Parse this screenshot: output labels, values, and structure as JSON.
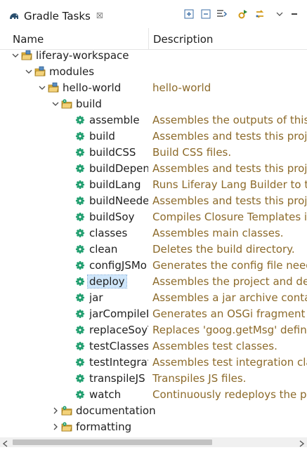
{
  "view": {
    "title": "Gradle Tasks",
    "close_glyph": "☒",
    "icon": "gradle-elephant-icon",
    "toolbar": [
      "expand-all-icon",
      "collapse-all-icon",
      "filter-icon",
      "run-tasks-icon",
      "refresh-icon",
      "view-menu-icon",
      "minimize-icon"
    ]
  },
  "columns": {
    "name": "Name",
    "description": "Description"
  },
  "tree": [
    {
      "label": "liferay-workspace",
      "desc": "",
      "level": 0,
      "state": "expanded",
      "kind": "project",
      "selected": false
    },
    {
      "label": "modules",
      "desc": "",
      "level": 1,
      "state": "expanded",
      "kind": "project",
      "selected": false
    },
    {
      "label": "hello-world",
      "desc": "hello-world",
      "level": 2,
      "state": "expanded",
      "kind": "project",
      "selected": false
    },
    {
      "label": "build",
      "desc": "",
      "level": 3,
      "state": "expanded",
      "kind": "group",
      "selected": false
    },
    {
      "label": "assemble",
      "desc": "Assembles the outputs of this pro",
      "level": 4,
      "state": "leaf",
      "kind": "task",
      "selected": false
    },
    {
      "label": "build",
      "desc": "Assembles and tests this project.",
      "level": 4,
      "state": "leaf",
      "kind": "task",
      "selected": false
    },
    {
      "label": "buildCSS",
      "desc": "Build CSS files.",
      "level": 4,
      "state": "leaf",
      "kind": "task",
      "selected": false
    },
    {
      "label": "buildDepen",
      "desc": "Assembles and tests this project a",
      "level": 4,
      "state": "leaf",
      "kind": "task",
      "selected": false
    },
    {
      "label": "buildLang",
      "desc": "Runs Liferay Lang Builder to trans",
      "level": 4,
      "state": "leaf",
      "kind": "task",
      "selected": false
    },
    {
      "label": "buildNeede",
      "desc": "Assembles and tests this project a",
      "level": 4,
      "state": "leaf",
      "kind": "task",
      "selected": false
    },
    {
      "label": "buildSoy",
      "desc": "Compiles Closure Templates into",
      "level": 4,
      "state": "leaf",
      "kind": "task",
      "selected": false
    },
    {
      "label": "classes",
      "desc": "Assembles main classes.",
      "level": 4,
      "state": "leaf",
      "kind": "task",
      "selected": false
    },
    {
      "label": "clean",
      "desc": "Deletes the build directory.",
      "level": 4,
      "state": "leaf",
      "kind": "task",
      "selected": false
    },
    {
      "label": "configJSMo",
      "desc": "Generates the config file needed",
      "level": 4,
      "state": "leaf",
      "kind": "task",
      "selected": false
    },
    {
      "label": "deploy",
      "desc": "Assembles the project and deploy",
      "level": 4,
      "state": "leaf",
      "kind": "task",
      "selected": true
    },
    {
      "label": "jar",
      "desc": "Assembles a jar archive containin",
      "level": 4,
      "state": "leaf",
      "kind": "task",
      "selected": false
    },
    {
      "label": "jarCompileI",
      "desc": "Generates an OSGi fragment cont",
      "level": 4,
      "state": "leaf",
      "kind": "task",
      "selected": false
    },
    {
      "label": "replaceSoyT",
      "desc": "Replaces 'goog.getMsg' definitior",
      "level": 4,
      "state": "leaf",
      "kind": "task",
      "selected": false
    },
    {
      "label": "testClasses",
      "desc": "Assembles test classes.",
      "level": 4,
      "state": "leaf",
      "kind": "task",
      "selected": false
    },
    {
      "label": "testIntegrati",
      "desc": "Assembles test integration classes",
      "level": 4,
      "state": "leaf",
      "kind": "task",
      "selected": false
    },
    {
      "label": "transpileJS",
      "desc": "Transpiles JS files.",
      "level": 4,
      "state": "leaf",
      "kind": "task",
      "selected": false
    },
    {
      "label": "watch",
      "desc": "Continuously redeploys the projec",
      "level": 4,
      "state": "leaf",
      "kind": "task",
      "selected": false
    },
    {
      "label": "documentation",
      "desc": "",
      "level": 3,
      "state": "collapsed",
      "kind": "group",
      "selected": false
    },
    {
      "label": "formatting",
      "desc": "",
      "level": 3,
      "state": "collapsed",
      "kind": "group",
      "selected": false
    }
  ],
  "colors": {
    "description_text": "#8c6a2a",
    "task_gear": "#1f9e6e",
    "folder": "#e2b33c",
    "selection": "#cfe6fa"
  },
  "scrollbar": {
    "horizontal_position": 0.0
  }
}
